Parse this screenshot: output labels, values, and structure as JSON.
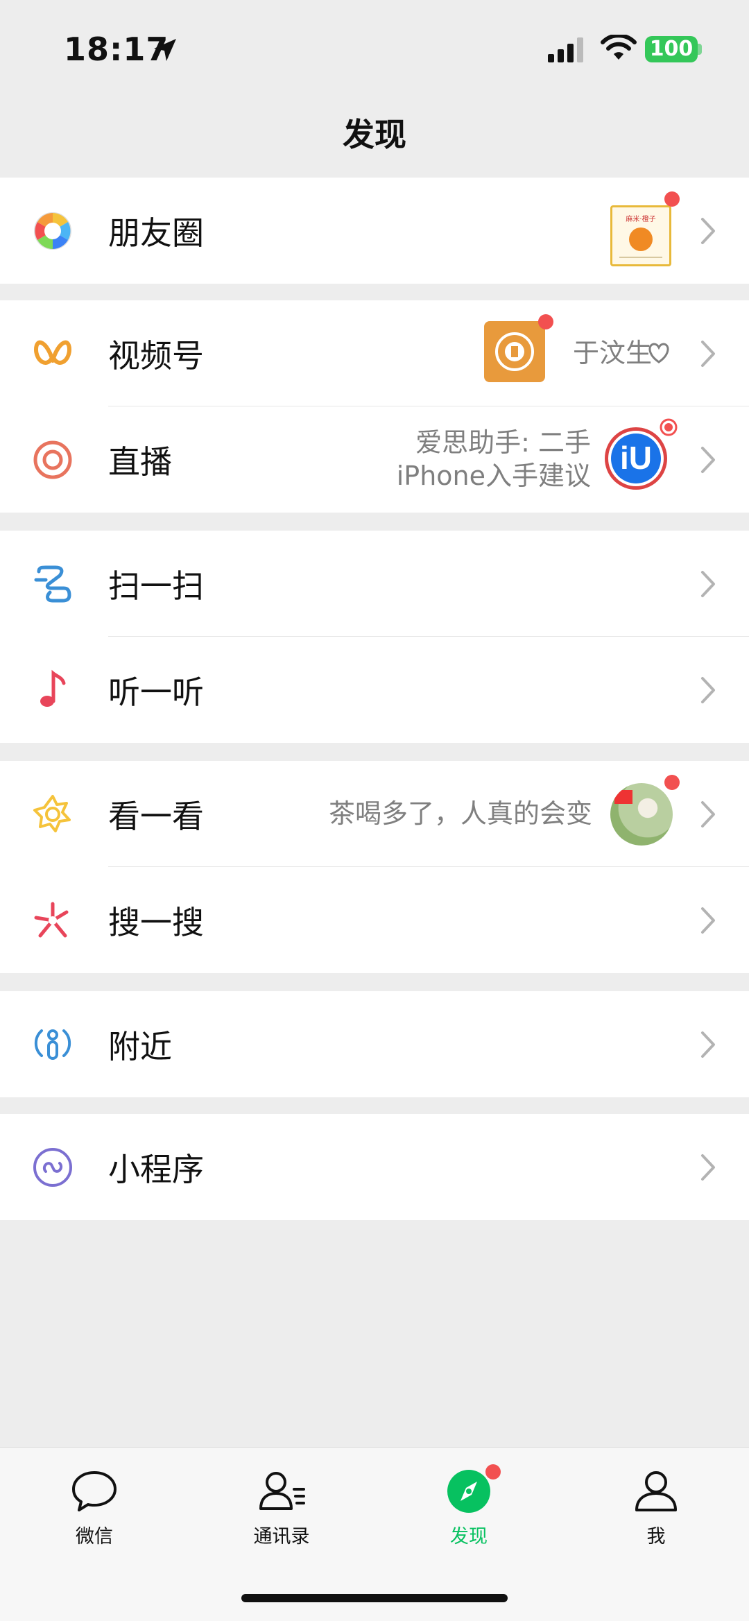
{
  "status_bar": {
    "time": "18:17",
    "battery": "100"
  },
  "nav": {
    "title": "发现"
  },
  "rows": {
    "moments": {
      "label": "朋友圈",
      "thumb_text": "麻米·橙子"
    },
    "channels": {
      "label": "视频号",
      "side_text": "于汶生"
    },
    "live": {
      "label": "直播",
      "side_line1": "爱思助手: 二手",
      "side_line2": "iPhone入手建议",
      "thumb_text": "iU"
    },
    "scan": {
      "label": "扫一扫"
    },
    "listen": {
      "label": "听一听"
    },
    "top_stories": {
      "label": "看一看",
      "side_text": "茶喝多了，人真的会变"
    },
    "search": {
      "label": "搜一搜"
    },
    "nearby": {
      "label": "附近"
    },
    "mini_programs": {
      "label": "小程序"
    }
  },
  "tabbar": {
    "tabs": [
      {
        "label": "微信",
        "icon": "chat-bubble-icon"
      },
      {
        "label": "通讯录",
        "icon": "contacts-icon"
      },
      {
        "label": "发现",
        "icon": "compass-icon",
        "active": true
      },
      {
        "label": "我",
        "icon": "person-icon"
      }
    ]
  },
  "colors": {
    "accent": "#07c160",
    "badge": "#f25050",
    "background": "#ededed"
  }
}
